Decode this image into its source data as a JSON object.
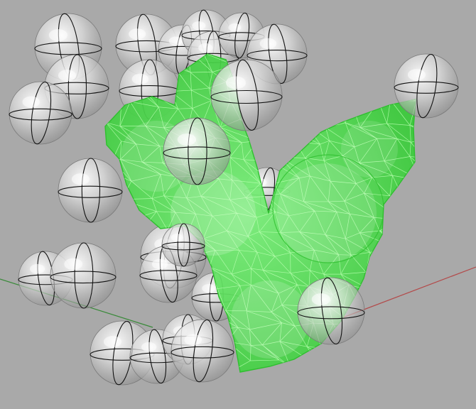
{
  "viewport": {
    "background_color": "#a9a9a9"
  },
  "colors": {
    "mesh_fill": "#45d445",
    "mesh_wire": "#b8ffb0",
    "mesh_edge": "#2fbf2f",
    "sphere_fill": "#d8d8d8",
    "sphere_ring": "#111111",
    "x_axis": "#b34a4a",
    "y_axis": "#3a8a3a"
  },
  "scene": {
    "object": "green-triangulated-mesh",
    "spheres_visible": 30
  }
}
